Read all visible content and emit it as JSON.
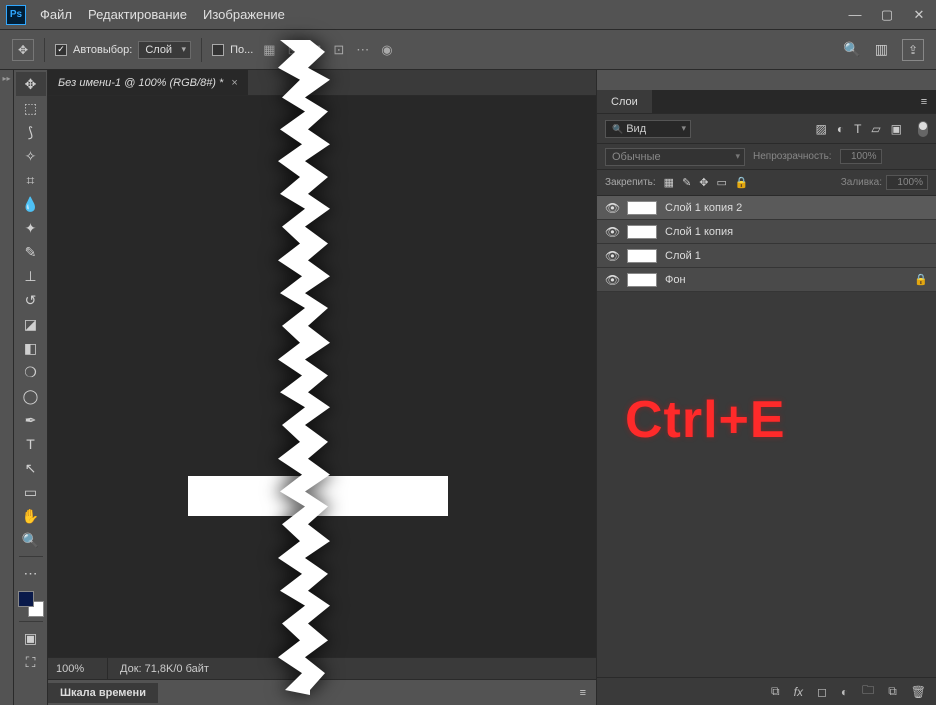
{
  "menu": {
    "items": [
      "Файл",
      "Редактирование",
      "Изображение"
    ]
  },
  "options": {
    "autoselect_label": "Автовыбор:",
    "target": "Слой",
    "show_controls_label": "По..."
  },
  "document": {
    "tab_title": "Без имени-1 @ 100% (RGB/8#) *",
    "zoom": "100%",
    "doc_info": "Док: 71,8K/0 байт"
  },
  "timeline": {
    "title": "Шкала времени"
  },
  "layers_panel": {
    "title": "Слои",
    "filter_kind": "Вид",
    "blend_mode": "Обычные",
    "opacity_label": "Непрозрачность:",
    "opacity_value": "100%",
    "lock_label": "Закрепить:",
    "fill_label": "Заливка:",
    "fill_value": "100%",
    "layers": [
      {
        "name": "Слой 1 копия 2",
        "locked": false,
        "selected": true
      },
      {
        "name": "Слой 1 копия",
        "locked": false,
        "selected": false
      },
      {
        "name": "Слой 1",
        "locked": false,
        "selected": false
      },
      {
        "name": "Фон",
        "locked": true,
        "selected": false
      }
    ]
  },
  "annotation": "Ctrl+E"
}
